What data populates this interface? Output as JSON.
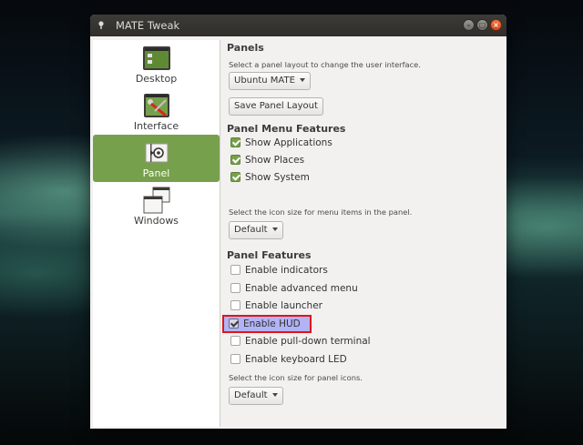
{
  "window": {
    "title": "MATE Tweak",
    "buttons": {
      "minimize": "–",
      "maximize": "□",
      "close": "×"
    }
  },
  "sidebar": {
    "items": [
      {
        "label": "Desktop",
        "icon": "desktop-icon",
        "active": false
      },
      {
        "label": "Interface",
        "icon": "interface-icon",
        "active": false
      },
      {
        "label": "Panel",
        "icon": "panel-icon",
        "active": true
      },
      {
        "label": "Windows",
        "icon": "windows-icon",
        "active": false
      }
    ]
  },
  "panels": {
    "heading": "Panels",
    "description": "Select a panel layout to change the user interface.",
    "layout_value": "Ubuntu MATE",
    "save_button": "Save Panel Layout"
  },
  "menu_features": {
    "heading": "Panel Menu Features",
    "items": [
      {
        "label": "Show Applications",
        "checked": true
      },
      {
        "label": "Show Places",
        "checked": true
      },
      {
        "label": "Show System",
        "checked": true
      }
    ],
    "icon_size_description": "Select the icon size for menu items in the panel.",
    "icon_size_value": "Default"
  },
  "panel_features": {
    "heading": "Panel Features",
    "items": [
      {
        "label": "Enable indicators",
        "checked": false
      },
      {
        "label": "Enable advanced menu",
        "checked": false
      },
      {
        "label": "Enable launcher",
        "checked": false
      },
      {
        "label": "Enable HUD",
        "checked": true,
        "highlighted": true
      },
      {
        "label": "Enable pull-down terminal",
        "checked": false
      },
      {
        "label": "Enable keyboard LED",
        "checked": false
      }
    ],
    "icon_size_description": "Select the icon size for panel icons.",
    "icon_size_value": "Default"
  },
  "colors": {
    "accent": "#77a04c",
    "highlight_fill": "#b1b3f4",
    "highlight_border": "#e0141a"
  }
}
